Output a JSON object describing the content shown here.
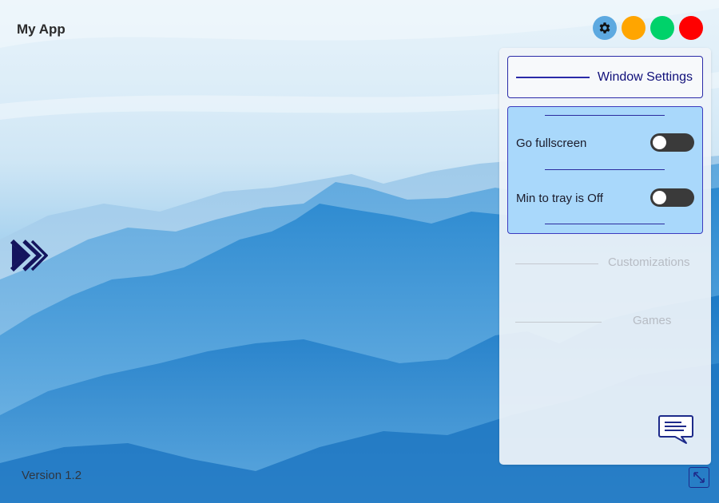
{
  "app": {
    "title": "My App",
    "version": "Version 1.2"
  },
  "titlebar": {
    "buttons": [
      {
        "name": "settings",
        "icon": "gear-icon",
        "color": "#5da9e0"
      },
      {
        "name": "minimize",
        "color": "#ffa500"
      },
      {
        "name": "maximize",
        "color": "#00d26a"
      },
      {
        "name": "close",
        "color": "#ff0000"
      }
    ]
  },
  "sidebar": {
    "expand_icon": "double-chevron-right-icon"
  },
  "panel": {
    "sections": [
      {
        "label": "Window Settings",
        "expanded": true
      },
      {
        "label": "Customizations",
        "expanded": false
      },
      {
        "label": "Games",
        "expanded": false
      }
    ],
    "window_settings": {
      "options": [
        {
          "label": "Go fullscreen",
          "on": false
        },
        {
          "label": "Min to tray is Off",
          "on": false
        }
      ]
    },
    "chat_icon": "chat-bubble-icon"
  },
  "footer": {
    "resize_icon": "resize-diagonal-icon"
  },
  "colors": {
    "accent": "#2a2aa8",
    "settings_bg": "#a9d8fb",
    "toggle_off": "#3a3a3a",
    "inactive_text": "#b7bcc4"
  }
}
